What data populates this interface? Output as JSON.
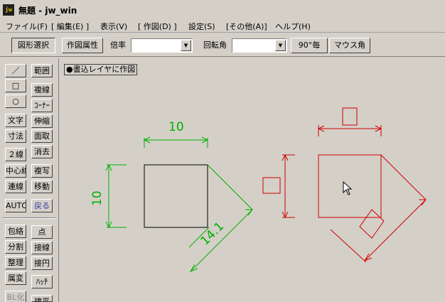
{
  "window": {
    "app_icon": "jw",
    "title": "無題 - jw_win"
  },
  "menu": [
    "ファイル(F)",
    "[ 編集(E) ]",
    "表示(V)",
    "[ 作図(D) ]",
    "設定(S)",
    "[その他(A)]",
    "ヘルプ(H)"
  ],
  "toolbar": {
    "shape_select": "図形選択",
    "draw_props": "作図属性",
    "scale_label": "倍率",
    "scale_value": "",
    "rotation_label": "回転角",
    "rotation_value": "",
    "angle_90": "90°毎",
    "mouse_angle": "マウス角"
  },
  "sidebar": {
    "left_col": [
      "／",
      "□",
      "○",
      "文字",
      "寸法",
      "２線",
      "中心線",
      "連線",
      "AUTO",
      "包絡",
      "分割",
      "整理",
      "属変",
      "BL化"
    ],
    "right_col": [
      "範囲",
      "複線",
      "ｺｰﾅｰ",
      "伸縮",
      "面取",
      "消去",
      "複写",
      "移動",
      "戻る",
      "点",
      "接線",
      "接円",
      "ﾊｯﾁ",
      "建平"
    ]
  },
  "canvas": {
    "status": "●書込レイヤに作図",
    "dim_horizontal": "10",
    "dim_vertical": "10",
    "dim_diagonal": "14.1",
    "colors": {
      "green": "#00b000",
      "red": "#d00000",
      "black": "#000000"
    }
  },
  "icons": {
    "pointer": "mouse-pointer-icon"
  }
}
